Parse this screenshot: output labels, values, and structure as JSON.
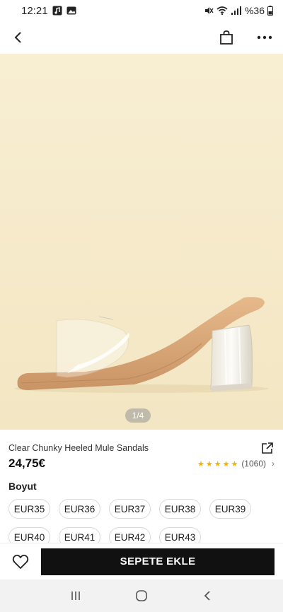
{
  "status_bar": {
    "time": "12:21",
    "battery": "%36"
  },
  "header": {
    "back_icon": "arrow-left-icon",
    "bag_icon": "shopping-bag-icon",
    "more_icon": "more-dots-icon"
  },
  "gallery": {
    "counter": "1/4",
    "background": "#f6ebcb"
  },
  "product": {
    "title": "Clear Chunky Heeled Mule Sandals",
    "price": "24,75€",
    "rating_stars": 5,
    "rating_count": "(1060)",
    "share_icon": "share-icon"
  },
  "sizes": {
    "label": "Boyut",
    "options": [
      "EUR35",
      "EUR36",
      "EUR37",
      "EUR38",
      "EUR39",
      "EUR40",
      "EUR41",
      "EUR42",
      "EUR43"
    ]
  },
  "actions": {
    "wishlist_icon": "heart-icon",
    "add_to_cart": "SEPETE EKLE"
  },
  "colors": {
    "accent_star": "#f5b301",
    "cta_background": "#111111"
  }
}
